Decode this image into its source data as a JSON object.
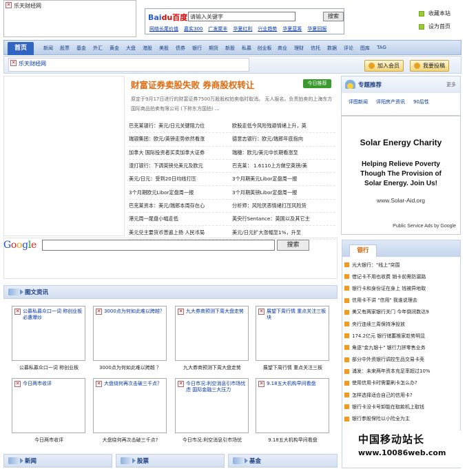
{
  "top": {
    "logo_alt": "乐天财经网",
    "search_logo": [
      "Bai",
      "du",
      "百度"
    ],
    "search_value": "请输入关键字",
    "search_button": "搜索",
    "hot_links": [
      "网络长尾价值",
      "嘉实300",
      "广发聚丰",
      "华夏红利",
      "兴业趋势",
      "华夏蓝筹",
      "华夏回报"
    ],
    "right_links": [
      "收藏本站",
      "设为首页"
    ]
  },
  "nav": {
    "home": "首页",
    "items": [
      "新闻",
      "股票",
      "基金",
      "外汇",
      "黄金",
      "大盘",
      "港股",
      "美股",
      "债券",
      "银行",
      "期货",
      "新股",
      "私募",
      "创业板",
      "商业",
      "理财",
      "信托",
      "数据",
      "评论",
      "图库",
      "TAG"
    ]
  },
  "sub": {
    "logo_alt": "乐天财经网",
    "join": "加入会员",
    "submit": "我要投稿"
  },
  "headline": {
    "title": "财富证券卖股失败 券商股权转让",
    "badge": "今日推荐",
    "summary_pre": "原定于9月17日进行的财富证券7500万股股权拍卖临时取消。 无人报名。负责拍卖的上海东方国际商品拍卖有限公司 (下称东方国拍) ",
    "summary_link": "...",
    "news": [
      [
        "巴克莱银行：美元/日元关键阻力位",
        "欧股走低今风险残避情绪上升，英"
      ],
      [
        "瑞银集团：欧元/英镑走势依然看涨",
        "德意志银行：欧元/瑞郎年底指向"
      ],
      [
        "加拿大 国际投资者买卖加拿大证券",
        "瑞穗：欧元/美元中长期看涨至"
      ],
      [
        "渣打银行：下调英镑兑美元及欧元",
        "巴克莱： 1.6110上方做空英镑/美"
      ],
      [
        "美元/日元：受到20日均线打压",
        "3个月期美元Libor定盘周一报"
      ],
      [
        "3个月期欧元Libor定盘周一报",
        "3个月期英镑Libor定盘周一报"
      ],
      [
        "巴克莱资本：美元/瑞郎本周存在心",
        "分析师：风险厌恶情绪打压风险货"
      ],
      [
        "港元周一尾盘小幅走低",
        "英央行Sentance：英国以及其它主"
      ],
      [
        "美元兑主要货币普遍上扬 人民币局",
        "美元/日元扩大涨幅至1%，升至"
      ]
    ]
  },
  "special": {
    "title": "专题推荐",
    "more": "更多",
    "links": [
      "评图新闻",
      "评阳房产资讯",
      "90后性"
    ]
  },
  "solar_ad": {
    "title": "Solar Energy Charity",
    "body": [
      "Helping Relieve Poverty",
      "Though The Provision of",
      "Solar Energy. Join Us!"
    ],
    "url": "www.Solar-Aid.org",
    "footer": "Public Service Ads by Google"
  },
  "google": {
    "logo_letters": [
      "G",
      "o",
      "o",
      "g",
      "l",
      "e"
    ],
    "logo_colors": [
      "#1a52c9",
      "#d22",
      "#e8a400",
      "#1a52c9",
      "#1a9a2a",
      "#d22"
    ],
    "button": "搜索"
  },
  "bank": {
    "tab": "银行",
    "items": [
      "光大银行：\"线上\"突围",
      "借记卡不用也收费 销卡前需防漏路",
      "银行卡和身份证在身上 钱被异地取",
      "信用卡不讲 \"信用\" 我谁说理去",
      "美又有两家银行关门 今年倒闭数达9",
      "央行连续三周保持净投放",
      "174.2亿元 银行储蓄推家趁势明显",
      "角逐\"金九银十\" 银行力拼零售业务",
      "部分中外资银行调控生品交易卡壳",
      "浦发：未来两年资本充足率超过10%",
      "使用信用卡时需要刷卡怎么办?",
      "怎样选择适合自己的信用卡?",
      "银行卡没卡号卸能在取款机上取钱",
      "银行参股保险以小险全为主"
    ]
  },
  "images": {
    "section_title": "图文资讯",
    "items": [
      {
        "alt": "公募私募众口一词 称创业板必遭爆炒",
        "caption": "公募私募众口一词 称创业板"
      },
      {
        "alt": "3000点为何如此难以跨越？",
        "caption": "3000点为何如此难以跨越 ？"
      },
      {
        "alt": "九大券商预测下周大盘走势",
        "caption": "九大券商预测下周大盘走势"
      },
      {
        "alt": "展望下周行情 重点关注三板块",
        "caption": "展望下周行情 重点关注三板"
      },
      {
        "alt": "今日两市收评",
        "caption": "今日两市收评"
      },
      {
        "alt": "大盘绕何再次击破三千点？",
        "caption": "大盘绕何再次击破三千点?"
      },
      {
        "alt": "今日市况:利空消息引市场忧虑 国际金融三大压力",
        "caption": "今日市况:利空消息引市场忧"
      },
      {
        "alt": "9.18五大机构早间看盘",
        "caption": "9.18五大机构早间看盘"
      }
    ]
  },
  "bottom": {
    "sections": [
      "新闻",
      "股票",
      "基金"
    ]
  },
  "watermark": {
    "line1": "中国移动站长",
    "line2": "www.10086web.com"
  }
}
